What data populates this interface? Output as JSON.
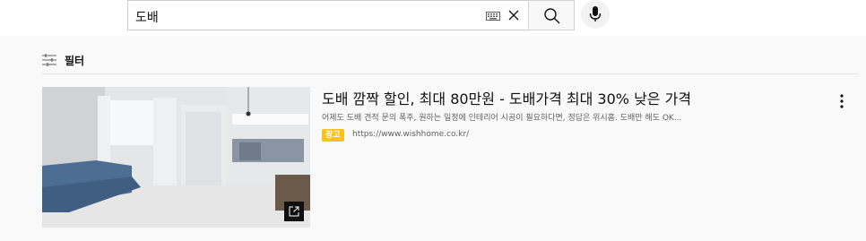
{
  "search": {
    "query": "도배"
  },
  "icons": {
    "keyboard": "keyboard-icon",
    "clear": "close-icon",
    "search": "search-icon",
    "mic": "microphone-icon",
    "filter": "filter-sliders-icon",
    "external": "open-external-icon",
    "more": "more-vert-icon"
  },
  "filter": {
    "label": "필터"
  },
  "ad": {
    "title": "도배 깜짝 할인, 최대 80만원 - 도배가격 최대 30% 낮은 가격",
    "description": "어제도 도배 견적 문의 폭주, 원하는 일정에 인테리어 시공이 필요하다면, 정답은 위시홈. 도배만 해도 OK...",
    "badge": "광고",
    "url": "https://www.wishhome.co.kr/"
  },
  "colors": {
    "ad_badge": "#f9c11b",
    "page_bg": "#f9f9f9",
    "text_primary": "#0f0f0f",
    "text_secondary": "#606060"
  }
}
